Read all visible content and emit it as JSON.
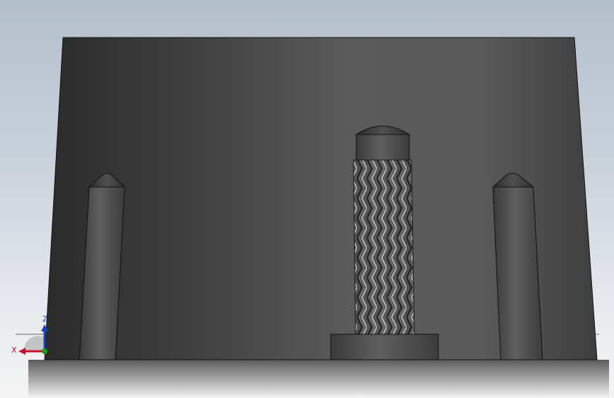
{
  "viewport": {
    "background_top": "#b4bfcc",
    "background_bottom": "#f4f4f4"
  },
  "model": {
    "body_color": "#4e4e4e",
    "edge_color": "#111111"
  },
  "triad": {
    "x_label": "X",
    "z_label": "Z",
    "x_color": "#c8102e",
    "y_color": "#1a9e1a",
    "z_color": "#1f3fbf"
  }
}
